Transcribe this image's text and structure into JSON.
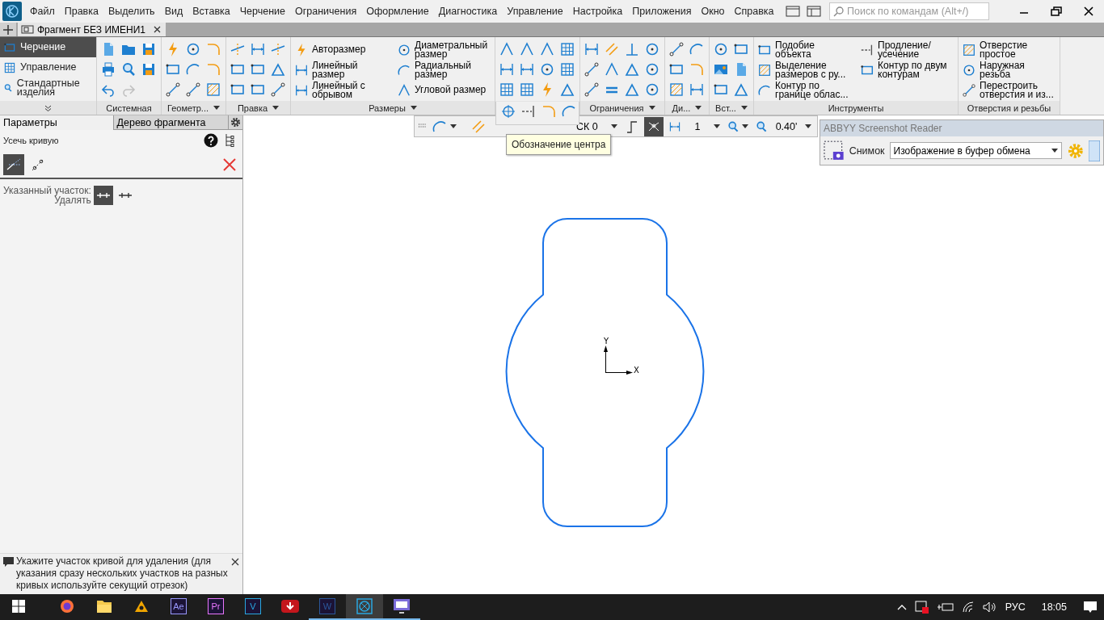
{
  "menu_bar": {
    "items": [
      "Файл",
      "Правка",
      "Выделить",
      "Вид",
      "Вставка",
      "Черчение",
      "Ограничения",
      "Оформление",
      "Диагностика",
      "Управление",
      "Настройка",
      "Приложения",
      "Окно",
      "Справка"
    ],
    "search": {
      "placeholder": "Поиск по командам (Alt+/)"
    }
  },
  "document_tabs": [
    {
      "label": "Фрагмент БЕЗ ИМЕНИ1",
      "selected": true
    }
  ],
  "ribbon": {
    "modes": [
      {
        "label": "Черчение",
        "selected": true
      },
      {
        "label": "Управление",
        "selected": false
      },
      {
        "label": "Стандартные изделия",
        "selected": false
      }
    ],
    "groups": [
      {
        "kind": "icons",
        "label": "Системная",
        "dropdown": false
      },
      {
        "kind": "icons",
        "label": "Геометр...",
        "dropdown": true
      },
      {
        "kind": "icons",
        "label": "Правка",
        "dropdown": true
      },
      {
        "kind": "commands",
        "label": "Размеры",
        "dropdown": true,
        "items": [
          "Авторазмер",
          "Линейный размер",
          "Линейный с обрывом",
          "Диаметральный размер",
          "Радиальный размер",
          "Угловой размер"
        ]
      },
      {
        "kind": "icons",
        "expanded": true,
        "tooltip": "Обозначение центра"
      },
      {
        "kind": "icons",
        "label": "Ограничения",
        "dropdown": true
      },
      {
        "kind": "icons",
        "label": "Ди...",
        "dropdown": true
      },
      {
        "kind": "icons",
        "label": "Вст...",
        "dropdown": true
      },
      {
        "kind": "commands",
        "label": "Инструменты",
        "dropdown": false,
        "items": [
          "Подобие объекта",
          "Выделение размеров с ру...",
          "Контур по границе облас...",
          "Продление/ усечение",
          "Контур по двум контурам"
        ]
      },
      {
        "kind": "commands",
        "label": "Отверстия и резьбы",
        "dropdown": false,
        "items": [
          "Отверстие простое",
          "Наружная резьба",
          "Перестроить отверстия и из..."
        ]
      }
    ]
  },
  "toolbar": {
    "cs_select": "СК 0",
    "snap_on": true,
    "step_value": "1",
    "zoom_value": "0.40'"
  },
  "abbyy": {
    "title": "ABBYY Screenshot Reader",
    "capture_label": "Снимок",
    "target_select": "Изображение в буфер обмена"
  },
  "left_panel": {
    "tabs": [
      {
        "label": "Параметры",
        "selected": true
      },
      {
        "label": "Дерево фрагмента",
        "selected": false
      }
    ],
    "command_title": "Усечь кривую",
    "modes": [
      {
        "selected": true
      },
      {
        "selected": false
      }
    ],
    "segment": {
      "label": "Указанный участок:",
      "action": "Удалять",
      "options": [
        {
          "selected": true
        },
        {
          "selected": false
        }
      ]
    },
    "hint": "Укажите участок кривой для удаления (для указания сразу нескольких участков на разных кривых используйте секущий отрезок)"
  },
  "canvas": {
    "axes": {
      "x": "X",
      "y": "Y"
    }
  },
  "taskbar": {
    "apps": [
      {
        "kind": "browser",
        "running": false,
        "active": false
      },
      {
        "kind": "folder",
        "running": false,
        "active": false
      },
      {
        "kind": "triangle",
        "running": false,
        "active": false
      },
      {
        "kind": "letter",
        "label": "Ae",
        "color": "#9999ff",
        "running": false,
        "active": false
      },
      {
        "kind": "letter",
        "label": "Pr",
        "color": "#ea77ff",
        "running": false,
        "active": false
      },
      {
        "kind": "letter",
        "label": "V",
        "color": "#29a8e0",
        "running": false,
        "active": false
      },
      {
        "kind": "download",
        "running": false,
        "active": false
      },
      {
        "kind": "letter",
        "label": "W",
        "color": "#2b579a",
        "running": true,
        "active": false
      },
      {
        "kind": "cad",
        "running": true,
        "active": true
      },
      {
        "kind": "monitor",
        "running": true,
        "active": false
      }
    ],
    "language": "РУС",
    "time": "18:05"
  }
}
